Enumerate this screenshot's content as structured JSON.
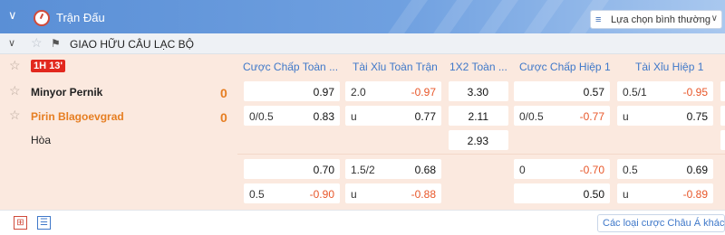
{
  "topbar": {
    "collapse_icon": "chevron-down-icon",
    "clock_icon": "stopwatch-icon",
    "title": "Trận Đấu",
    "select_label": "Lựa chọn bình thường",
    "select_icon": "list-icon"
  },
  "league": {
    "name": "GIAO HỮU CÂU LẠC BỘ"
  },
  "match": {
    "time_badge": "1H 13'",
    "columns": [
      "Cược Chấp Toàn ...",
      "Tài Xỉu Toàn Trận",
      "1X2 Toàn ...",
      "Cược Chấp Hiệp 1",
      "Tài Xỉu Hiệp 1"
    ],
    "home": {
      "name": "Minyor Pernik",
      "score": "0"
    },
    "away": {
      "name": "Pirin Blagoevgrad",
      "score": "0"
    },
    "draw_label": "Hòa",
    "colors": {
      "live_red": "#e2281e",
      "negative_odds": "#e8572a",
      "header_blue": "#3f78c9",
      "row_bg": "#fbe9df"
    }
  },
  "odds": {
    "main": {
      "hdp_home": {
        "line": "",
        "price": "0.97"
      },
      "hdp_away": {
        "line": "0/0.5",
        "price": "0.83"
      },
      "ou_over": {
        "line": "2.0",
        "price": "-0.97"
      },
      "ou_under": {
        "line": "u",
        "price": "0.77"
      },
      "x12_home": "3.30",
      "x12_away": "2.11",
      "x12_draw": "2.93",
      "h1hdp_home": {
        "line": "",
        "price": "0.57"
      },
      "h1hdp_away": {
        "line": "0/0.5",
        "price": "-0.77"
      },
      "h1ou_over": {
        "line": "0.5/1",
        "price": "-0.95"
      },
      "h1ou_under": {
        "line": "u",
        "price": "0.75"
      }
    },
    "alt": {
      "hdp_home": {
        "line": "",
        "price": "0.70"
      },
      "hdp_away": {
        "line": "0.5",
        "price": "-0.90"
      },
      "ou_over": {
        "line": "1.5/2",
        "price": "0.68"
      },
      "ou_under": {
        "line": "u",
        "price": "-0.88"
      },
      "h1hdp_home": {
        "line": "0",
        "price": "-0.70"
      },
      "h1hdp_away": {
        "line": "",
        "price": "0.50"
      },
      "h1ou_over": {
        "line": "0.5",
        "price": "0.69"
      },
      "h1ou_under": {
        "line": "u",
        "price": "-0.89"
      }
    }
  },
  "bottom": {
    "icon_left": "stats-grid-icon",
    "icon_right": "document-icon",
    "link_label": "Các loại cược Châu Á khác"
  }
}
